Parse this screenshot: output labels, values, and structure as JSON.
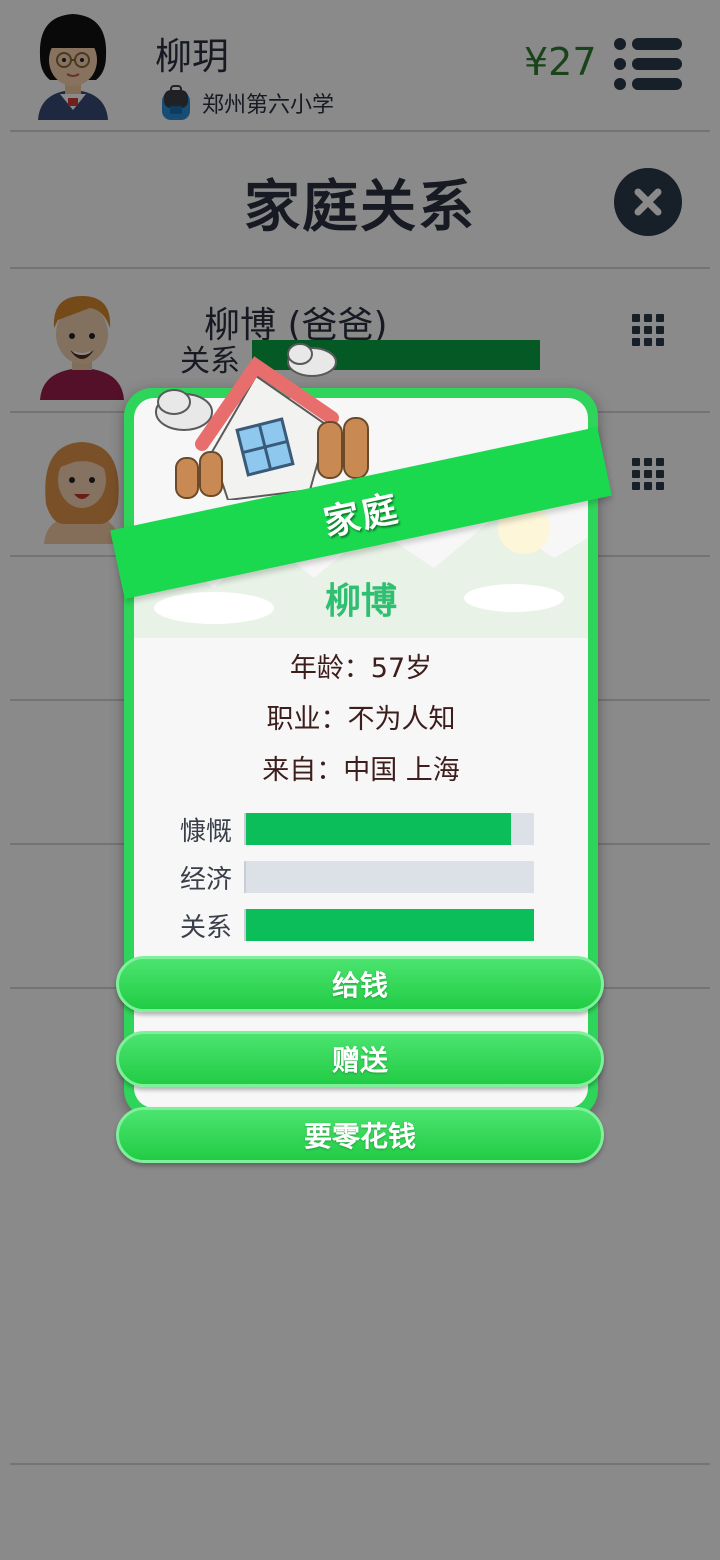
{
  "header": {
    "player_name": "柳玥",
    "school": "郑州第六小学",
    "money": "¥27"
  },
  "page": {
    "title": "家庭关系"
  },
  "family": {
    "members": [
      {
        "name": "柳博 (爸爸)",
        "relation_label": "关系",
        "relation_level": 1.0
      }
    ]
  },
  "modal": {
    "category": "家庭",
    "name": "柳博",
    "age_line": "年龄：57岁",
    "job_line": "职业：不为人知",
    "origin_line": "来自：中国 上海",
    "stats": [
      {
        "label": "慷慨",
        "level": 0.92
      },
      {
        "label": "经济",
        "level": 0.0
      },
      {
        "label": "关系",
        "level": 1.0
      }
    ],
    "buttons": {
      "give_money": "给钱",
      "gift": "赠送",
      "ask_allowance": "要零花钱"
    }
  },
  "colors": {
    "accent_green": "#1ad94e",
    "bar_green": "#0cbe59",
    "money_green": "#2f7d2f",
    "dark_text": "#2b3040"
  }
}
